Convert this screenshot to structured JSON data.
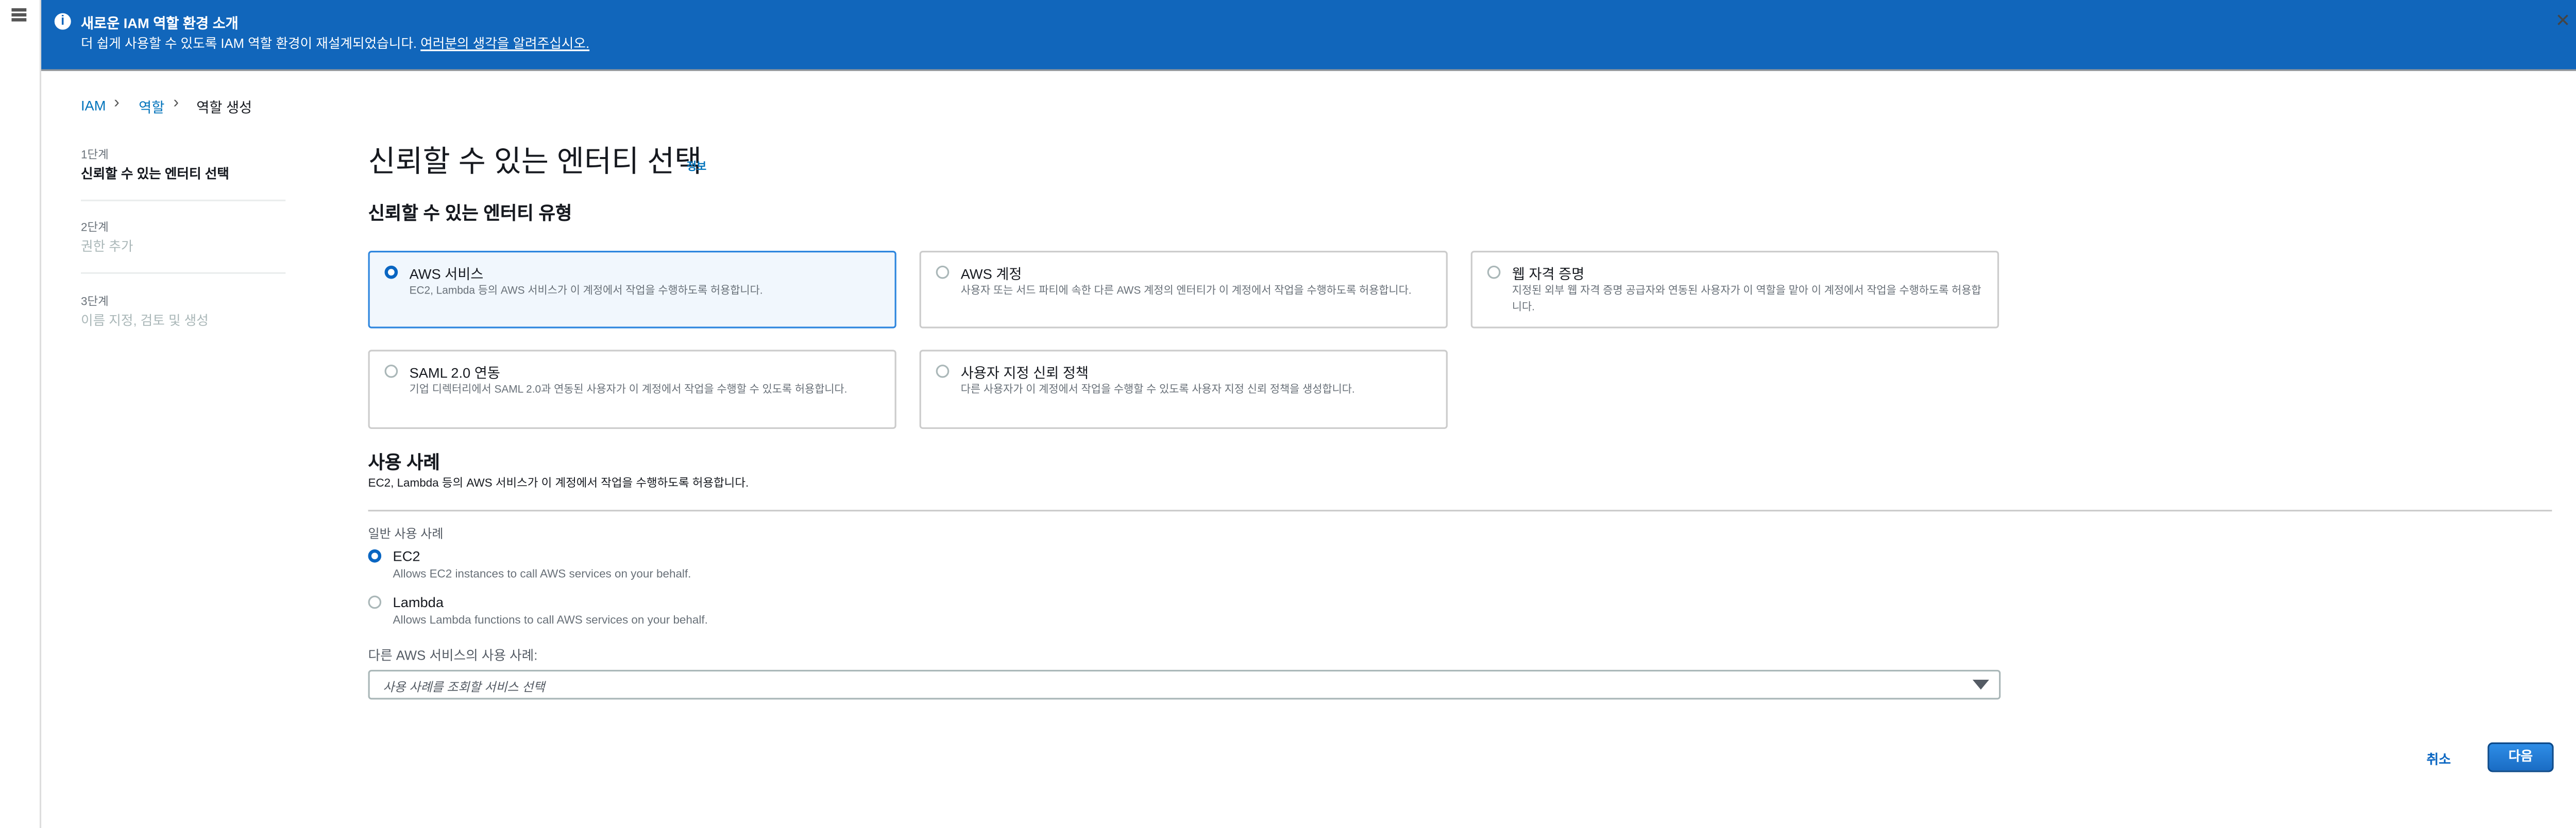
{
  "banner": {
    "title": "새로운 IAM 역할 환경 소개",
    "message": "더 쉽게 사용할 수 있도록 IAM 역할 환경이 재설계되었습니다. ",
    "feedback_link": "여러분의 생각을 알려주십시오.",
    "info_icon_glyph": "i",
    "close_glyph": "✕"
  },
  "breadcrumb": [
    "IAM",
    "역할",
    "역할 생성"
  ],
  "steps": [
    {
      "label": "1단계",
      "name": "신뢰할 수 있는 엔터티 선택"
    },
    {
      "label": "2단계",
      "name": "권한 추가"
    },
    {
      "label": "3단계",
      "name": "이름 지정, 검토 및 생성"
    }
  ],
  "page": {
    "title": "신뢰할 수 있는 엔터티 선택",
    "info": "정보"
  },
  "entity_type": {
    "heading": "신뢰할 수 있는 엔터티 유형",
    "options": [
      {
        "title": "AWS 서비스",
        "desc": "EC2, Lambda 등의 AWS 서비스가 이 계정에서 작업을 수행하도록 허용합니다.",
        "selected": true
      },
      {
        "title": "AWS 계정",
        "desc": "사용자 또는 서드 파티에 속한 다른 AWS 계정의 엔터티가 이 계정에서 작업을 수행하도록 허용합니다.",
        "selected": false
      },
      {
        "title": "웹 자격 증명",
        "desc": "지정된 외부 웹 자격 증명 공급자와 연동된 사용자가 이 역할을 맡아 이 계정에서 작업을 수행하도록 허용합니다.",
        "selected": false
      },
      {
        "title": "SAML 2.0 연동",
        "desc": "기업 디렉터리에서 SAML 2.0과 연동된 사용자가 이 계정에서 작업을 수행할 수 있도록 허용합니다.",
        "selected": false
      },
      {
        "title": "사용자 지정 신뢰 정책",
        "desc": "다른 사용자가 이 계정에서 작업을 수행할 수 있도록 사용자 지정 신뢰 정책을 생성합니다.",
        "selected": false
      }
    ]
  },
  "use_case": {
    "heading": "사용 사례",
    "desc": "EC2, Lambda 등의 AWS 서비스가 이 계정에서 작업을 수행하도록 허용합니다.",
    "common_label": "일반 사용 사례",
    "options": [
      {
        "title": "EC2",
        "desc": "Allows EC2 instances to call AWS services on your behalf.",
        "selected": true
      },
      {
        "title": "Lambda",
        "desc": "Allows Lambda functions to call AWS services on your behalf.",
        "selected": false
      }
    ],
    "other_label": "다른 AWS 서비스의 사용 사례:",
    "select_placeholder": "사용 사례를 조회할 서비스 선택"
  },
  "footer": {
    "cancel": "취소",
    "next": "다음"
  },
  "colors": {
    "banner": "#1166bb",
    "accent": "#0a66c2"
  }
}
